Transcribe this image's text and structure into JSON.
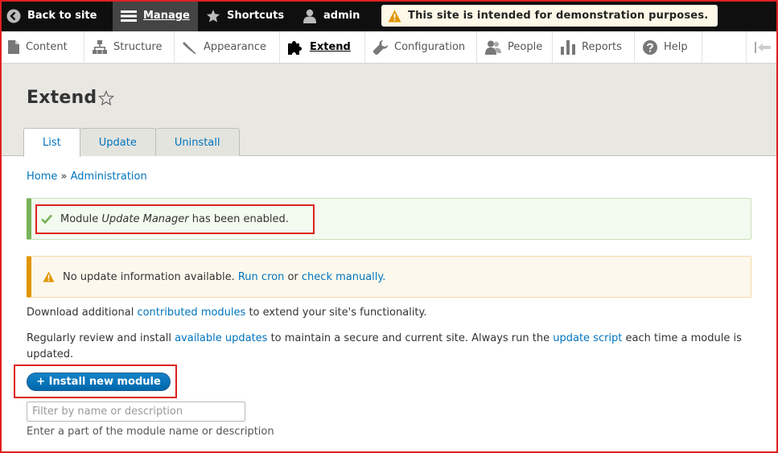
{
  "toolbar": {
    "back_label": "Back to site",
    "manage_label": "Manage",
    "shortcuts_label": "Shortcuts",
    "user_label": "admin",
    "demo_notice": "This site is intended for demonstration purposes."
  },
  "tray": {
    "items": [
      {
        "label": "Content",
        "icon": "file-icon"
      },
      {
        "label": "Structure",
        "icon": "sitemap-icon"
      },
      {
        "label": "Appearance",
        "icon": "paintbrush-icon"
      },
      {
        "label": "Extend",
        "icon": "puzzle-icon",
        "active": true
      },
      {
        "label": "Configuration",
        "icon": "wrench-icon"
      },
      {
        "label": "People",
        "icon": "people-icon"
      },
      {
        "label": "Reports",
        "icon": "bar-chart-icon"
      },
      {
        "label": "Help",
        "icon": "help-icon"
      }
    ]
  },
  "page": {
    "title": "Extend",
    "tabs": [
      {
        "label": "List",
        "active": true
      },
      {
        "label": "Update"
      },
      {
        "label": "Uninstall"
      }
    ]
  },
  "breadcrumb": {
    "home": "Home",
    "separator": " » ",
    "admin": "Administration"
  },
  "messages": {
    "status": {
      "before": "Module ",
      "module_name": "Update Manager",
      "after": " has been enabled."
    },
    "warning": {
      "text": "No update information available. ",
      "run_cron": "Run cron",
      "or": " or ",
      "check_manually": "check manually",
      "end": "."
    }
  },
  "body": {
    "p1_before": "Download additional ",
    "p1_link": "contributed modules",
    "p1_after": " to extend your site's functionality.",
    "p2_before": "Regularly review and install ",
    "p2_link1": "available updates",
    "p2_middle": " to maintain a secure and current site. Always run the ",
    "p2_link2": "update script",
    "p2_after": " each time a module is updated."
  },
  "install_button": "+ Install new module",
  "filter": {
    "placeholder": "Filter by name or description",
    "value": "",
    "description": "Enter a part of the module name or description"
  },
  "colors": {
    "toolbar_bg": "#0f0f0f",
    "link": "#0074bd",
    "status_border": "#77b259",
    "warning_border": "#e09600",
    "highlight": "#e02020"
  }
}
